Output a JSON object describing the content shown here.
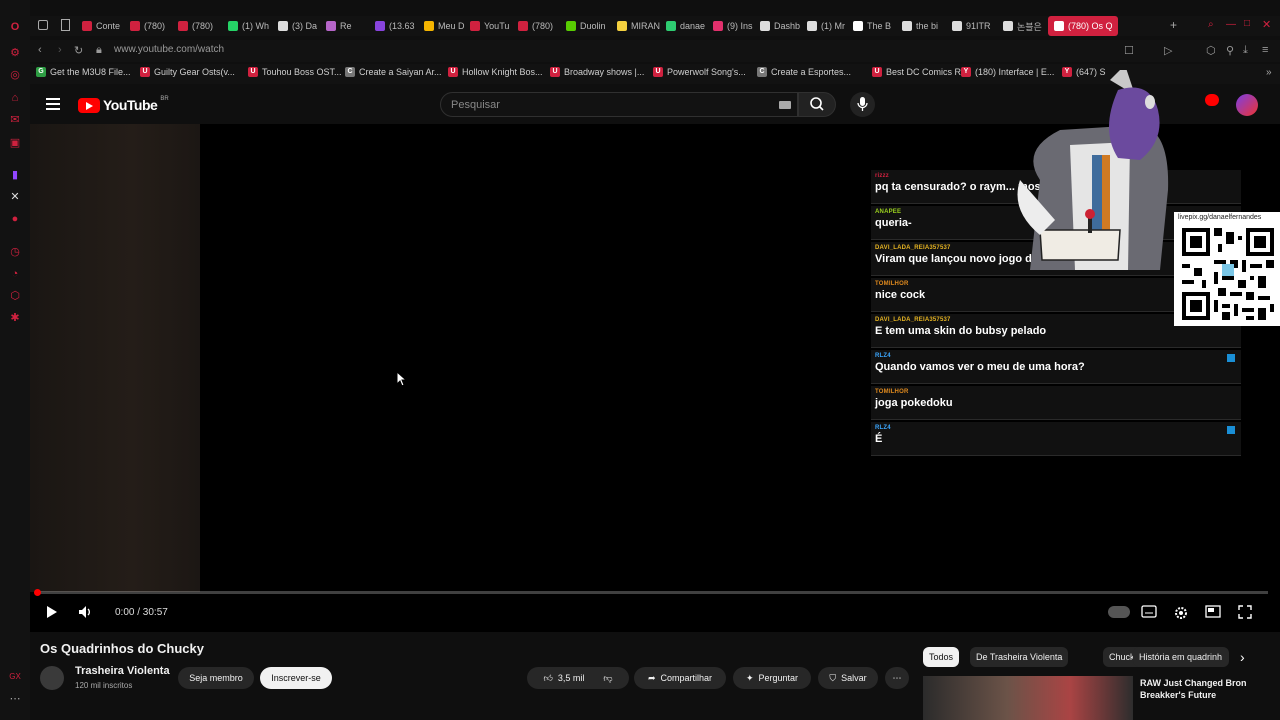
{
  "browser": {
    "tabs": [
      {
        "label": "Conte",
        "color": "#d0213f"
      },
      {
        "label": "(780)",
        "color": "#d0213f"
      },
      {
        "label": "(780)",
        "color": "#d0213f"
      },
      {
        "label": "(1) Wh",
        "color": "#25d366"
      },
      {
        "label": "(3) Da",
        "color": "#dddddd"
      },
      {
        "label": "Re",
        "color": "#b565c8"
      },
      {
        "label": "(13.63",
        "color": "#8844dd"
      },
      {
        "label": "Meu D",
        "color": "#f4b400"
      },
      {
        "label": "YouTu",
        "color": "#d0213f"
      },
      {
        "label": "(780)",
        "color": "#d0213f"
      },
      {
        "label": "Duolin",
        "color": "#58cc02"
      },
      {
        "label": "MIRAN",
        "color": "#f4d03f"
      },
      {
        "label": "danae",
        "color": "#2ecc71"
      },
      {
        "label": "(9) Ins",
        "color": "#e1306c"
      },
      {
        "label": "Dashb",
        "color": "#dddddd"
      },
      {
        "label": "(1) Mr",
        "color": "#dddddd"
      },
      {
        "label": "The B",
        "color": "#ffffff"
      },
      {
        "label": "the bi",
        "color": "#dddddd"
      },
      {
        "label": "91ITR",
        "color": "#dddddd"
      },
      {
        "label": "논블은",
        "color": "#dddddd"
      },
      {
        "label": "(780) Os Q",
        "color": "#ffffff"
      }
    ],
    "url": "www.youtube.com/watch",
    "bookmarks": [
      {
        "label": "Get the M3U8 File...",
        "icon": "G"
      },
      {
        "label": "Guilty Gear Osts(v...",
        "icon": "U"
      },
      {
        "label": "Touhou Boss OST...",
        "icon": "U"
      },
      {
        "label": "Create a Saiyan Ar...",
        "icon": "C"
      },
      {
        "label": "Hollow Knight Bos...",
        "icon": "U"
      },
      {
        "label": "Broadway shows |...",
        "icon": "U"
      },
      {
        "label": "Powerwolf Song's...",
        "icon": "U"
      },
      {
        "label": "Create a Esportes...",
        "icon": "C"
      },
      {
        "label": "Best DC Comics R...",
        "icon": "U"
      },
      {
        "label": "(180) Interface | E...",
        "icon": "Y"
      },
      {
        "label": "(647) S",
        "icon": "Y"
      }
    ]
  },
  "youtube": {
    "logo_text": "YouTube",
    "country": "BR",
    "search_placeholder": "Pesquisar"
  },
  "player": {
    "time": "0:00 / 30:57",
    "progress_fraction": 0.0
  },
  "chat": [
    {
      "user": "rizzz",
      "text": "pq ta censurado? o raym... mostrou o pau?]",
      "color": "#d0213f",
      "badge": false
    },
    {
      "user": "ANAPEE",
      "text": "queria-",
      "color": "#9bd11e",
      "badge": false
    },
    {
      "user": "DAVI_LADA_REIA357537",
      "text": "Viram que lançou novo jogo do bubsy?",
      "color": "#e6b422",
      "badge": false
    },
    {
      "user": "TOMILHOR",
      "text": "nice cock",
      "color": "#e08a1e",
      "badge": false
    },
    {
      "user": "DAVI_LADA_REIA357537",
      "text": "E tem uma skin do bubsy pelado",
      "color": "#e6b422",
      "badge": false
    },
    {
      "user": "RLZ4",
      "text": "Quando vamos ver o meu de uma hora?",
      "color": "#3ba7ff",
      "badge": true
    },
    {
      "user": "TOMILHOR",
      "text": "joga pokedoku",
      "color": "#e08a1e",
      "badge": false
    },
    {
      "user": "RLZ4",
      "text": "É",
      "color": "#3ba7ff",
      "badge": true
    }
  ],
  "overlay": {
    "qr_url": "livepix.gg/danaelfernandes"
  },
  "video": {
    "title": "Os Quadrinhos do Chucky",
    "channel": "Trasheira Violenta",
    "subscribers": "120 mil inscritos",
    "member_label": "Seja membro",
    "subscribe_label": "Inscrever-se",
    "likes": "3,5 mil",
    "share_label": "Compartilhar",
    "ask_label": "Perguntar",
    "save_label": "Salvar"
  },
  "chips": [
    "Todos",
    "De Trasheira Violenta",
    "Chucky",
    "História em quadrinh"
  ],
  "recommendation": {
    "title": "RAW Just Changed Bron Breakker's Future"
  },
  "colors": {
    "accent": "#d0213f",
    "yt_red": "#ff0000",
    "bg": "#0f0f0f"
  }
}
